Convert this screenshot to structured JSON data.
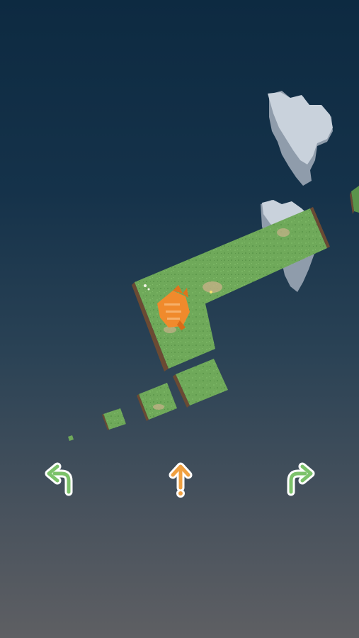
{
  "game": {
    "controls": {
      "turn_left": {
        "icon": "turn-left-arrow-icon",
        "color": "#7cc26a"
      },
      "forward": {
        "icon": "forward-arrow-icon",
        "color": "#f0a040"
      },
      "turn_right": {
        "icon": "turn-right-arrow-icon",
        "color": "#7cc26a"
      }
    },
    "palette": {
      "sky_top": "#0d2a41",
      "sky_bottom": "#5e5f63",
      "grass": "#6fa95a",
      "grass_dark": "#5a934a",
      "dirt": "#6b4a33",
      "cloud": "#c9d2dc",
      "cloud_shadow": "#8f9cab",
      "cat": "#f08a2c",
      "button_outline": "#ffffff"
    }
  }
}
